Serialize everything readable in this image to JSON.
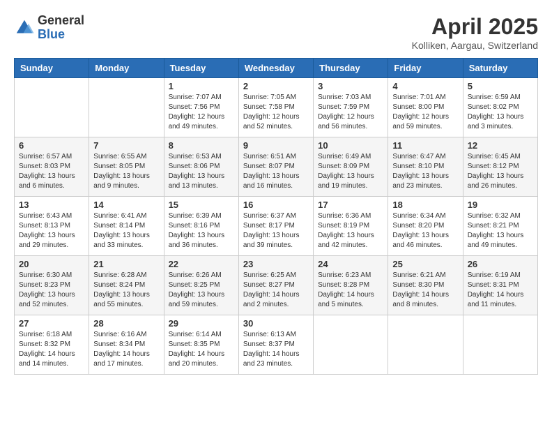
{
  "header": {
    "logo_general": "General",
    "logo_blue": "Blue",
    "month_title": "April 2025",
    "location": "Kolliken, Aargau, Switzerland"
  },
  "days_of_week": [
    "Sunday",
    "Monday",
    "Tuesday",
    "Wednesday",
    "Thursday",
    "Friday",
    "Saturday"
  ],
  "weeks": [
    [
      {
        "day": "",
        "info": ""
      },
      {
        "day": "",
        "info": ""
      },
      {
        "day": "1",
        "info": "Sunrise: 7:07 AM\nSunset: 7:56 PM\nDaylight: 12 hours and 49 minutes."
      },
      {
        "day": "2",
        "info": "Sunrise: 7:05 AM\nSunset: 7:58 PM\nDaylight: 12 hours and 52 minutes."
      },
      {
        "day": "3",
        "info": "Sunrise: 7:03 AM\nSunset: 7:59 PM\nDaylight: 12 hours and 56 minutes."
      },
      {
        "day": "4",
        "info": "Sunrise: 7:01 AM\nSunset: 8:00 PM\nDaylight: 12 hours and 59 minutes."
      },
      {
        "day": "5",
        "info": "Sunrise: 6:59 AM\nSunset: 8:02 PM\nDaylight: 13 hours and 3 minutes."
      }
    ],
    [
      {
        "day": "6",
        "info": "Sunrise: 6:57 AM\nSunset: 8:03 PM\nDaylight: 13 hours and 6 minutes."
      },
      {
        "day": "7",
        "info": "Sunrise: 6:55 AM\nSunset: 8:05 PM\nDaylight: 13 hours and 9 minutes."
      },
      {
        "day": "8",
        "info": "Sunrise: 6:53 AM\nSunset: 8:06 PM\nDaylight: 13 hours and 13 minutes."
      },
      {
        "day": "9",
        "info": "Sunrise: 6:51 AM\nSunset: 8:07 PM\nDaylight: 13 hours and 16 minutes."
      },
      {
        "day": "10",
        "info": "Sunrise: 6:49 AM\nSunset: 8:09 PM\nDaylight: 13 hours and 19 minutes."
      },
      {
        "day": "11",
        "info": "Sunrise: 6:47 AM\nSunset: 8:10 PM\nDaylight: 13 hours and 23 minutes."
      },
      {
        "day": "12",
        "info": "Sunrise: 6:45 AM\nSunset: 8:12 PM\nDaylight: 13 hours and 26 minutes."
      }
    ],
    [
      {
        "day": "13",
        "info": "Sunrise: 6:43 AM\nSunset: 8:13 PM\nDaylight: 13 hours and 29 minutes."
      },
      {
        "day": "14",
        "info": "Sunrise: 6:41 AM\nSunset: 8:14 PM\nDaylight: 13 hours and 33 minutes."
      },
      {
        "day": "15",
        "info": "Sunrise: 6:39 AM\nSunset: 8:16 PM\nDaylight: 13 hours and 36 minutes."
      },
      {
        "day": "16",
        "info": "Sunrise: 6:37 AM\nSunset: 8:17 PM\nDaylight: 13 hours and 39 minutes."
      },
      {
        "day": "17",
        "info": "Sunrise: 6:36 AM\nSunset: 8:19 PM\nDaylight: 13 hours and 42 minutes."
      },
      {
        "day": "18",
        "info": "Sunrise: 6:34 AM\nSunset: 8:20 PM\nDaylight: 13 hours and 46 minutes."
      },
      {
        "day": "19",
        "info": "Sunrise: 6:32 AM\nSunset: 8:21 PM\nDaylight: 13 hours and 49 minutes."
      }
    ],
    [
      {
        "day": "20",
        "info": "Sunrise: 6:30 AM\nSunset: 8:23 PM\nDaylight: 13 hours and 52 minutes."
      },
      {
        "day": "21",
        "info": "Sunrise: 6:28 AM\nSunset: 8:24 PM\nDaylight: 13 hours and 55 minutes."
      },
      {
        "day": "22",
        "info": "Sunrise: 6:26 AM\nSunset: 8:25 PM\nDaylight: 13 hours and 59 minutes."
      },
      {
        "day": "23",
        "info": "Sunrise: 6:25 AM\nSunset: 8:27 PM\nDaylight: 14 hours and 2 minutes."
      },
      {
        "day": "24",
        "info": "Sunrise: 6:23 AM\nSunset: 8:28 PM\nDaylight: 14 hours and 5 minutes."
      },
      {
        "day": "25",
        "info": "Sunrise: 6:21 AM\nSunset: 8:30 PM\nDaylight: 14 hours and 8 minutes."
      },
      {
        "day": "26",
        "info": "Sunrise: 6:19 AM\nSunset: 8:31 PM\nDaylight: 14 hours and 11 minutes."
      }
    ],
    [
      {
        "day": "27",
        "info": "Sunrise: 6:18 AM\nSunset: 8:32 PM\nDaylight: 14 hours and 14 minutes."
      },
      {
        "day": "28",
        "info": "Sunrise: 6:16 AM\nSunset: 8:34 PM\nDaylight: 14 hours and 17 minutes."
      },
      {
        "day": "29",
        "info": "Sunrise: 6:14 AM\nSunset: 8:35 PM\nDaylight: 14 hours and 20 minutes."
      },
      {
        "day": "30",
        "info": "Sunrise: 6:13 AM\nSunset: 8:37 PM\nDaylight: 14 hours and 23 minutes."
      },
      {
        "day": "",
        "info": ""
      },
      {
        "day": "",
        "info": ""
      },
      {
        "day": "",
        "info": ""
      }
    ]
  ]
}
